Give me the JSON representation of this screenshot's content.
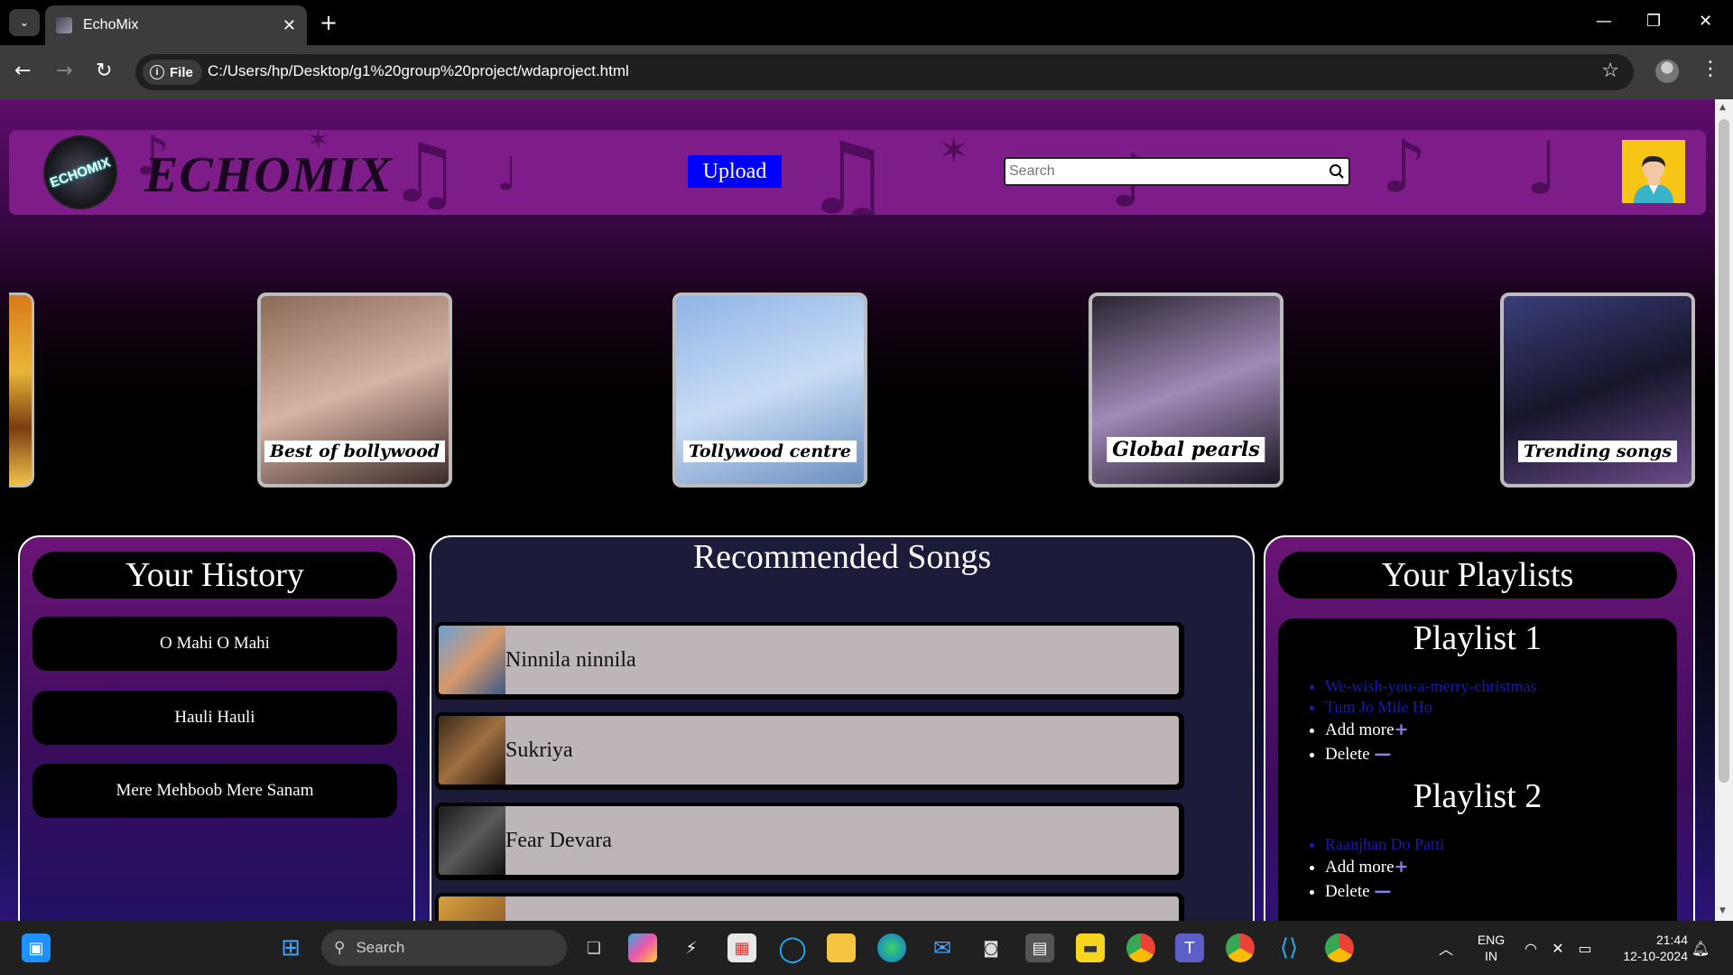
{
  "browser": {
    "tab_title": "EchoMix",
    "tab_close": "✕",
    "new_tab": "+",
    "site_chip": "File",
    "url": "C:/Users/hp/Desktop/g1%20group%20project/wdaproject.html"
  },
  "header": {
    "logo_text": "ECHOMIX",
    "brand": "ECHOMIX",
    "upload_label": "Upload",
    "search_placeholder": "Search"
  },
  "carousel": [
    {
      "label": "Best of bollywood",
      "colors": [
        "#8a6a58",
        "#d7b3a3",
        "#3b2a2a"
      ]
    },
    {
      "label": "Tollywood centre",
      "colors": [
        "#8fb4e6",
        "#c8dcf5",
        "#6a8fc0"
      ]
    },
    {
      "label": "Global pearls",
      "colors": [
        "#2a2430",
        "#9f8ab8",
        "#1a1420"
      ]
    },
    {
      "label": "Trending songs",
      "colors": [
        "#3b3e7a",
        "#16162a",
        "#6a4a8a"
      ]
    }
  ],
  "history": {
    "title": "Your History",
    "items": [
      "O Mahi O Mahi",
      "Hauli Hauli",
      "Mere Mehboob Mere Sanam"
    ]
  },
  "recommended": {
    "title": "Recommended Songs",
    "songs": [
      "Ninnila ninnila",
      "Sukriya",
      "Fear Devara",
      ""
    ]
  },
  "playlists": {
    "title": "Your Playlists",
    "lists": [
      {
        "name": "Playlist 1",
        "songs": [
          "We-wish-you-a-merry-christmas",
          "Tum Jo Mile Ho"
        ],
        "add": "Add more",
        "delete": "Delete"
      },
      {
        "name": "Playlist 2",
        "songs": [
          "Raanjhan Do Patti"
        ],
        "add": "Add more",
        "delete": "Delete"
      }
    ]
  },
  "taskbar": {
    "search_label": "Search",
    "lang_line1": "ENG",
    "lang_line2": "IN",
    "time": "21:44",
    "date": "12-10-2024"
  }
}
